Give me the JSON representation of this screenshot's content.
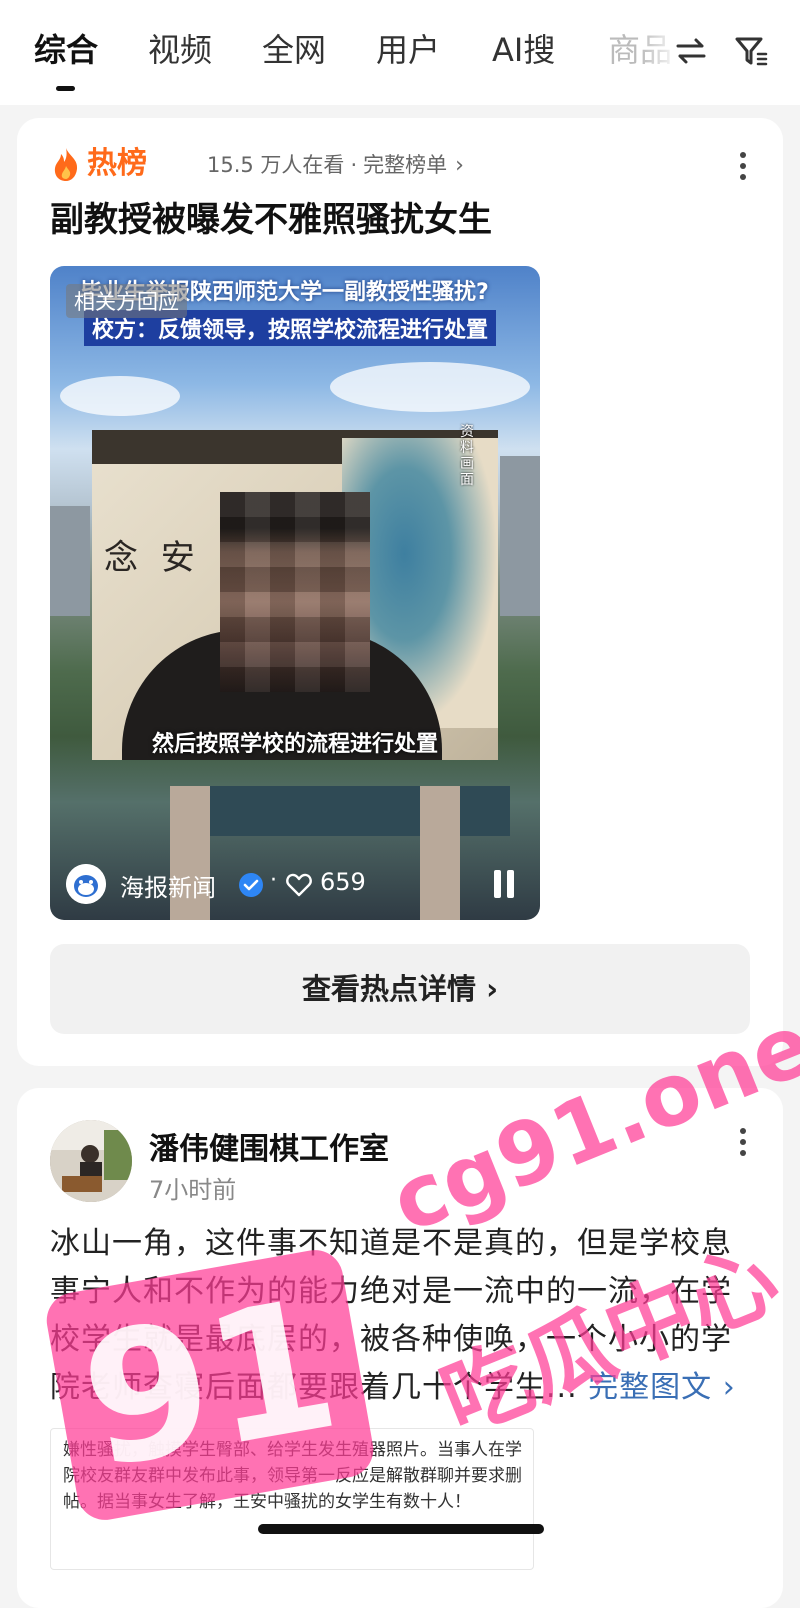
{
  "tabs": [
    {
      "label": "综合",
      "active": true
    },
    {
      "label": "视频"
    },
    {
      "label": "全网"
    },
    {
      "label": "用户"
    },
    {
      "label": "AI搜"
    },
    {
      "label": "商品"
    }
  ],
  "icons": {
    "sort": "swap-arrows-icon",
    "filter": "filter-icon",
    "more": "more-dots-icon"
  },
  "hot_card": {
    "label": "热榜",
    "viewers": "15.5 万人在看",
    "full_list": "完整榜单",
    "headline": "副教授被曝发不雅照骚扰女生",
    "video": {
      "banner_line1": "毕业生举报陕西师范大学一副教授性骚扰?",
      "banner_line2": "校方：反馈领导，按照学校流程进行处置",
      "related_tag": "相关方回应",
      "vertical_caption": "资料画面",
      "calligraphy": "念 安",
      "subtitle": "然后按照学校的流程进行处置",
      "source": "海报新闻",
      "likes": "659"
    },
    "detail_button": "查看热点详情"
  },
  "post_card": {
    "author": "潘伟健围棋工作室",
    "time": "7小时前",
    "text": "冰山一角，这件事不知道是不是真的，但是学校息事宁人和不作为的能力绝对是一流中的一流，在学校学生就是最底层的，被各种使唤，一个小小的学院老师查寝后面都要跟着几十个学生...",
    "full_link": "完整图文",
    "preview_text": "嫌性骚扰，触摸学生臀部、给学生发生殖器照片。当事人在学院校友群友群中发布此事，领导第一反应是解散群聊并要求删帖。据当事女生了解，王安中骚扰的女学生有数十人！"
  },
  "watermark": {
    "domain": "cg91.one",
    "cn": "吃瓜中心",
    "logo": "91"
  },
  "colors": {
    "hot_orange": "#ff6a1a",
    "link_blue": "#3a6fb5",
    "watermark_pink": "#ff3c96"
  }
}
